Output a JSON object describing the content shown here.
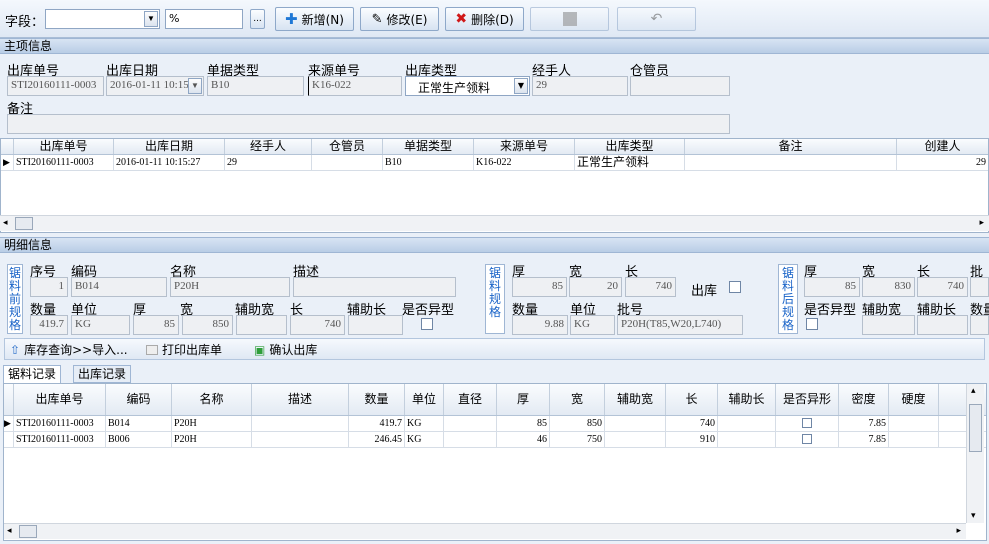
{
  "toolbar": {
    "field_label": "字段：",
    "field_value": "",
    "match_value": "%",
    "ellipsis": "...",
    "add": "新增(N)",
    "edit": "修改(E)",
    "delete": "删除(D)"
  },
  "main": {
    "title": "主项信息",
    "labels": {
      "outno": "出库单号",
      "outdate": "出库日期",
      "doctype": "单据类型",
      "srcno": "来源单号",
      "outtype": "出库类型",
      "handler": "经手人",
      "keeper": "仓管员",
      "remark": "备注"
    },
    "values": {
      "outno": "STI20160111-0003",
      "outdate": "2016-01-11 10:15:2",
      "doctype": "B10",
      "srcno": "K16-022",
      "outtype": "正常生产领料",
      "handler": "29",
      "keeper": "",
      "remark": ""
    }
  },
  "main_grid": {
    "columns": [
      "出库单号",
      "出库日期",
      "经手人",
      "仓管员",
      "单据类型",
      "来源单号",
      "出库类型",
      "备注",
      "创建人"
    ],
    "rows": [
      [
        "STI20160111-0003",
        "2016-01-11 10:15:27",
        "29",
        "",
        "B10",
        "K16-022",
        "正常生产领料",
        "",
        "29"
      ]
    ]
  },
  "detail": {
    "title": "明细信息",
    "before_label": "锯料前规格",
    "spec_label": "锯料规格",
    "after_label": "锯料后规格",
    "labels": {
      "seq": "序号",
      "code": "编码",
      "name": "名称",
      "desc": "描述",
      "qty": "数量",
      "unit": "单位",
      "thick": "厚",
      "width": "宽",
      "auxwidth": "辅助宽",
      "length": "长",
      "auxlength": "辅助长",
      "irregular": "是否异型",
      "batch": "批号",
      "out": "出库",
      "batchshort": "批"
    },
    "values": {
      "seq": "1",
      "code": "B014",
      "name": "P20H",
      "desc": "",
      "qty": "419.7",
      "unit": "KG",
      "thick": "85",
      "width": "850",
      "auxwidth": "",
      "length": "740",
      "auxlength": "",
      "s_thick": "85",
      "s_width": "20",
      "s_length": "740",
      "s_qty": "9.88",
      "s_unit": "KG",
      "s_batch": "P20H(T85,W20,L740)",
      "a_thick": "85",
      "a_width": "830",
      "a_length": "740"
    },
    "actions": {
      "inventory": "库存查询>>导入...",
      "print": "打印出库单",
      "confirm": "确认出库"
    }
  },
  "tabs": [
    "锯料记录",
    "出库记录"
  ],
  "detail_grid": {
    "columns": [
      "出库单号",
      "编码",
      "名称",
      "描述",
      "数量",
      "单位",
      "直径",
      "厚",
      "宽",
      "辅助宽",
      "长",
      "辅助长",
      "是否异形",
      "密度",
      "硬度"
    ],
    "rows": [
      [
        "STI20160111-0003",
        "B014",
        "P20H",
        "",
        "419.7",
        "KG",
        "",
        "85",
        "850",
        "",
        "740",
        "",
        "",
        "7.85",
        ""
      ],
      [
        "STI20160111-0003",
        "B006",
        "P20H",
        "",
        "246.45",
        "KG",
        "",
        "46",
        "750",
        "",
        "910",
        "",
        "",
        "7.85",
        ""
      ]
    ]
  }
}
